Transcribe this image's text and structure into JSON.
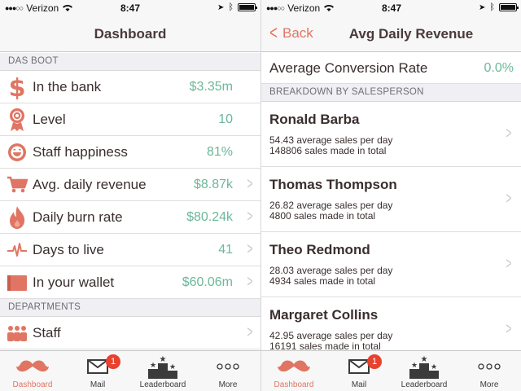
{
  "colors": {
    "accent": "#e07563",
    "value_green": "#6bb89a",
    "badge_red": "#e8412e"
  },
  "left": {
    "status": {
      "carrier": "Verizon",
      "time": "8:47"
    },
    "nav": {
      "title": "Dashboard"
    },
    "sections": {
      "das_boot": "DAS BOOT",
      "departments": "DEPARTMENTS"
    },
    "rows": [
      {
        "label": "In the bank",
        "value": "$3.35m",
        "icon": "dollar-icon"
      },
      {
        "label": "Level",
        "value": "10",
        "icon": "ribbon-icon"
      },
      {
        "label": "Staff happiness",
        "value": "81%",
        "icon": "smiley-icon"
      },
      {
        "label": "Avg. daily revenue",
        "value": "$8.87k",
        "icon": "cart-icon"
      },
      {
        "label": "Daily burn rate",
        "value": "$80.24k",
        "icon": "flame-icon"
      },
      {
        "label": "Days to live",
        "value": "41",
        "icon": "heartbeat-icon"
      },
      {
        "label": "In your wallet",
        "value": "$60.06m",
        "icon": "wallet-icon"
      }
    ],
    "dept_rows": [
      {
        "label": "Staff",
        "icon": "people-icon"
      }
    ]
  },
  "right": {
    "status": {
      "carrier": "Verizon",
      "time": "8:47"
    },
    "nav": {
      "back_label": "Back",
      "title": "Avg Daily Revenue"
    },
    "conversion": {
      "label": "Average Conversion Rate",
      "value": "0.0%"
    },
    "section": "BREAKDOWN BY SALESPERSON",
    "people": [
      {
        "name": "Ronald Barba",
        "avg": "54.43 average sales per day",
        "total": "148806 sales made in total"
      },
      {
        "name": "Thomas Thompson",
        "avg": "26.82 average sales per day",
        "total": "4800 sales made in total"
      },
      {
        "name": "Theo Redmond",
        "avg": "28.03 average sales per day",
        "total": "4934 sales made in total"
      },
      {
        "name": "Margaret Collins",
        "avg": "42.95 average sales per day",
        "total": "16191 sales made in total"
      }
    ]
  },
  "tabs": [
    {
      "label": "Dashboard",
      "icon": "mustache-icon"
    },
    {
      "label": "Mail",
      "icon": "envelope-icon",
      "badge": "1"
    },
    {
      "label": "Leaderboard",
      "icon": "podium-icon"
    },
    {
      "label": "More",
      "icon": "more-dots-icon"
    }
  ]
}
